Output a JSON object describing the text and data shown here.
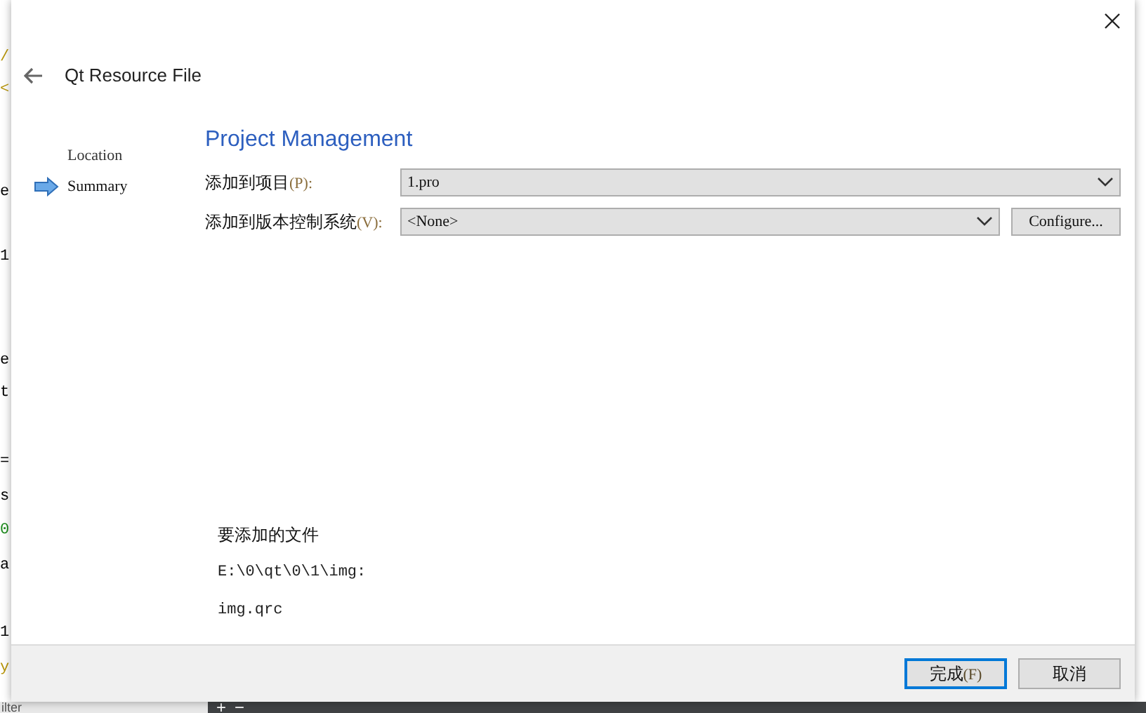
{
  "editor_fragments": [
    {
      "text": "/",
      "color": "#b8960c"
    },
    {
      "text": "<",
      "color": "#b8960c"
    },
    {
      "text": "e",
      "color": "#000000"
    },
    {
      "text": "1",
      "color": "#000000"
    },
    {
      "text": "e",
      "color": "#000000"
    },
    {
      "text": "t",
      "color": "#000000"
    },
    {
      "text": "=",
      "color": "#000000"
    },
    {
      "text": "s",
      "color": "#000000"
    },
    {
      "text": "0",
      "color": "#1a8a1a"
    },
    {
      "text": "a",
      "color": "#000000"
    },
    {
      "text": "1",
      "color": "#000000"
    },
    {
      "text": "y",
      "color": "#b8960c"
    }
  ],
  "editor_bottom": {
    "filter": "ilter",
    "add": "+",
    "remove": "−"
  },
  "dialog": {
    "title": "Qt Resource File",
    "steps": [
      {
        "label": "Location",
        "selected": false
      },
      {
        "label": "Summary",
        "selected": true
      }
    ],
    "heading": "Project Management",
    "fields": [
      {
        "label": "添加到项目",
        "mnemonic": "(P):",
        "value": "1.pro"
      },
      {
        "label": "添加到版本控制系统",
        "mnemonic": "(V):",
        "value": "<None>",
        "button": "Configure..."
      }
    ],
    "files_heading": "要添加的文件",
    "files_path": "E:\\0\\qt\\0\\1\\img:",
    "files": [
      "img.qrc"
    ],
    "buttons": [
      {
        "label": "完成",
        "mnemonic": "(F)",
        "default": true
      },
      {
        "label": "取消",
        "default": false
      }
    ]
  }
}
